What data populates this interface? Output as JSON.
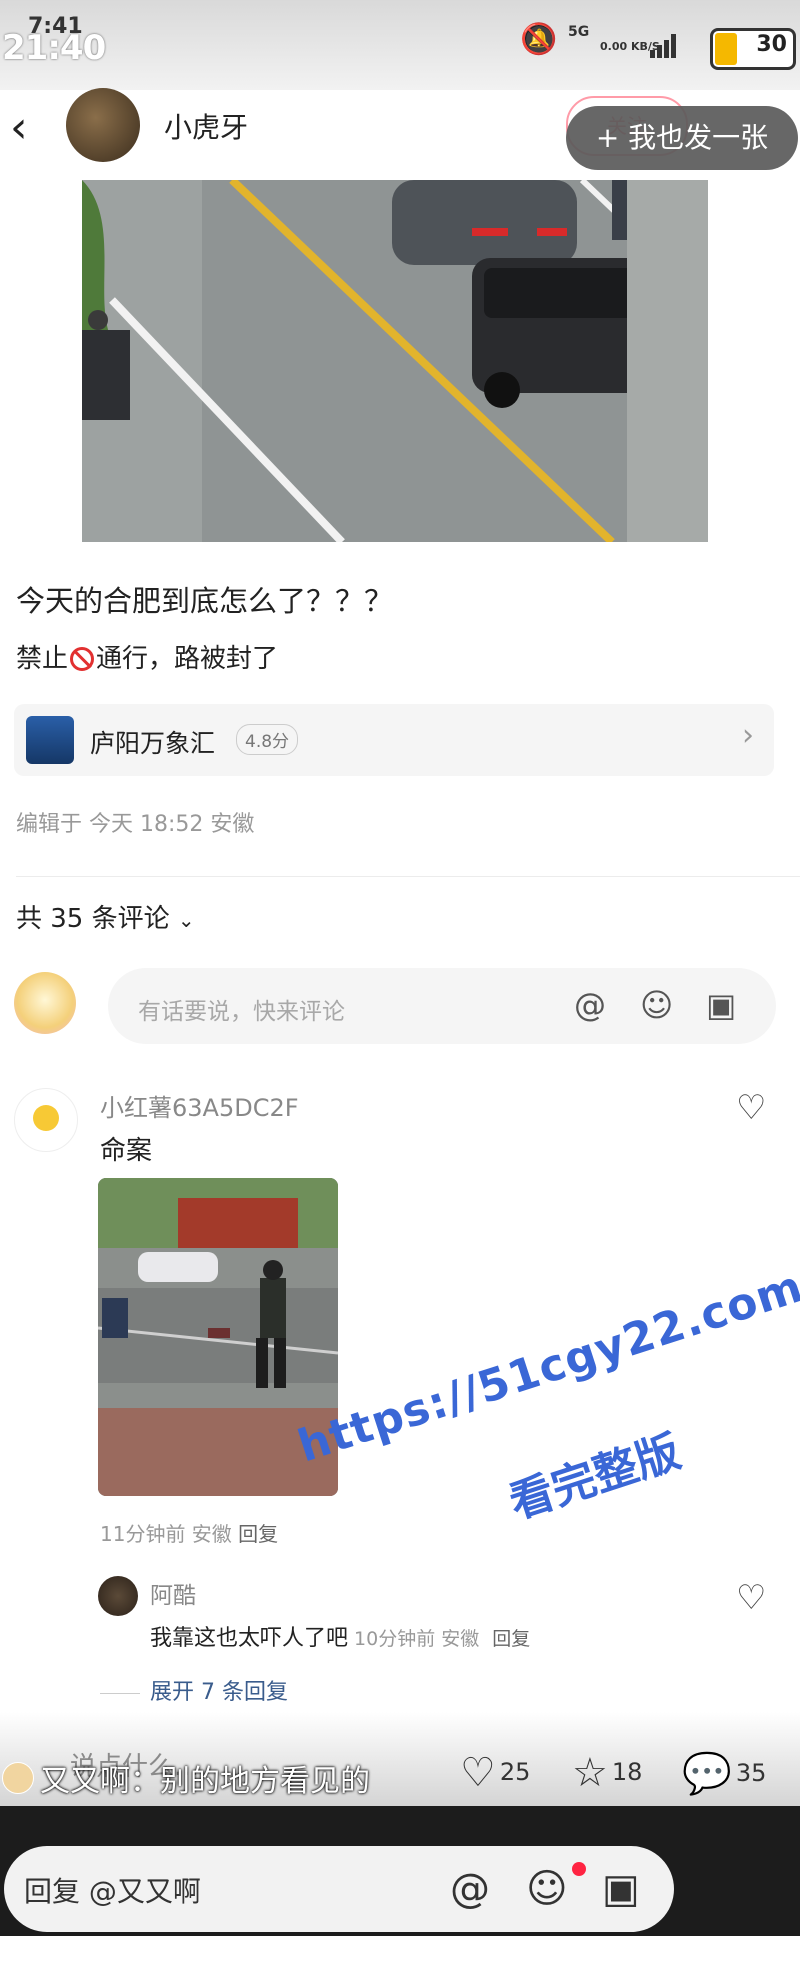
{
  "status_bar": {
    "time_big": "21:40",
    "time_small": "7:41",
    "signal_label": "5G",
    "speed_label": "0.00 KB/S",
    "battery": "30"
  },
  "header": {
    "author": "小虎牙",
    "follow": "关注",
    "post_same": "+ 我也发一张"
  },
  "post": {
    "title": "今天的合肥到底怎么了？？？",
    "body_before": "禁止",
    "body_after": "通行，路被封了",
    "location_name": "庐阳万象汇",
    "location_score": "4.8分",
    "edited": "编辑于 今天 18:52 安徽"
  },
  "comments": {
    "count_label": "共 35 条评论",
    "input_placeholder": "有话要说，快来评论",
    "items": [
      {
        "user": "小红薯63A5DC2F",
        "text": "命案",
        "meta": "11分钟前 安徽",
        "reply": "回复",
        "replies": [
          {
            "user": "阿酷",
            "text": "我靠这也太吓人了吧",
            "meta": "10分钟前 安徽",
            "reply": "回复"
          }
        ],
        "expand": "展开 7 条回复"
      }
    ]
  },
  "bottom": {
    "say_placeholder": "说点什么...",
    "danmu": "又又啊：别的地方看见的",
    "likes": "25",
    "stars": "18",
    "comments": "35",
    "reply_placeholder": "回复 @又又啊"
  },
  "watermark": {
    "url": "https://51cgy22.com",
    "text": "看完整版"
  },
  "colors": {
    "accent": "#ff2442",
    "watermark": "#3a67d6"
  }
}
